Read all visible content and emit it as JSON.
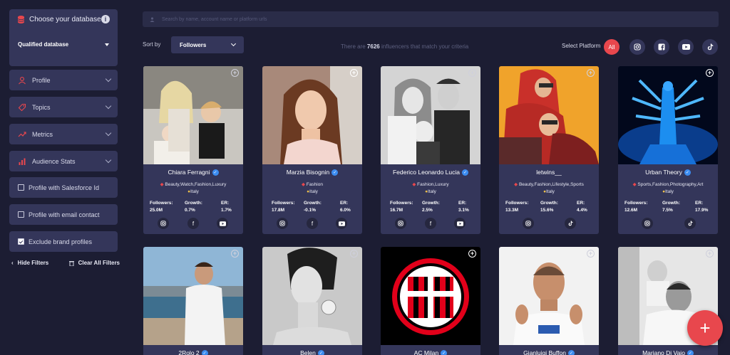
{
  "sidebar": {
    "database_title": "Choose your database",
    "database_value": "Qualified database",
    "filters": [
      {
        "label": "Profile"
      },
      {
        "label": "Topics"
      },
      {
        "label": "Metrics"
      },
      {
        "label": "Audience Stats"
      }
    ],
    "checks": [
      {
        "label": "Profile with Salesforce Id",
        "checked": false
      },
      {
        "label": "Profile with email contact",
        "checked": false
      },
      {
        "label": "Exclude brand profiles",
        "checked": true
      }
    ],
    "hide_filters": "Hide Filters",
    "clear_filters": "Clear All Filters"
  },
  "search": {
    "placeholder": "Search by name, account name or platform urls"
  },
  "sort": {
    "label": "Sort by",
    "value": "Followers"
  },
  "results": {
    "prefix": "There are",
    "count": "7626",
    "suffix": "influencers that match your criteria"
  },
  "platforms": {
    "label": "Select Platform",
    "all": "All"
  },
  "cards": [
    {
      "name": "Chiara Ferragni",
      "cats": "Beauty,Watch,Fashion,Luxury",
      "country": "Italy",
      "followers": "25.0M",
      "growth": "0.7%",
      "er": "1.7%",
      "socials": [
        "instagram",
        "facebook",
        "youtube"
      ]
    },
    {
      "name": "Marzia Bisognin",
      "cats": "Fashion",
      "country": "Italy",
      "followers": "17.8M",
      "growth": "-0.1%",
      "er": "6.0%",
      "socials": [
        "instagram",
        "facebook",
        "youtube"
      ]
    },
    {
      "name": "Federico Leonardo Lucia",
      "cats": "Fashion,Luxury",
      "country": "Italy",
      "followers": "16.7M",
      "growth": "2.5%",
      "er": "3.1%",
      "socials": [
        "instagram",
        "facebook",
        "youtube"
      ]
    },
    {
      "name": "letwins__",
      "cats": "Beauty,Fashion,Lifestyle,Sports",
      "country": "Italy",
      "followers": "13.3M",
      "growth": "15.6%",
      "er": "4.4%",
      "socials": [
        "instagram",
        "tiktok"
      ]
    },
    {
      "name": "Urban Theory",
      "cats": "Sports,Fashion,Photography,Art",
      "country": "Italy",
      "followers": "12.6M",
      "growth": "7.5%",
      "er": "17.9%",
      "socials": [
        "instagram",
        "tiktok"
      ]
    }
  ],
  "row2_names": [
    "2Rolo 2",
    "Belen",
    "AC Milan",
    "Gianluigi Buffon",
    "Mariano Di Vaio"
  ],
  "stat_labels": {
    "followers": "Followers:",
    "growth": "Growth:",
    "er": "ER:"
  },
  "colors": {
    "accent": "#e8474d",
    "panel": "#34365a",
    "bg": "#1c1d33"
  }
}
